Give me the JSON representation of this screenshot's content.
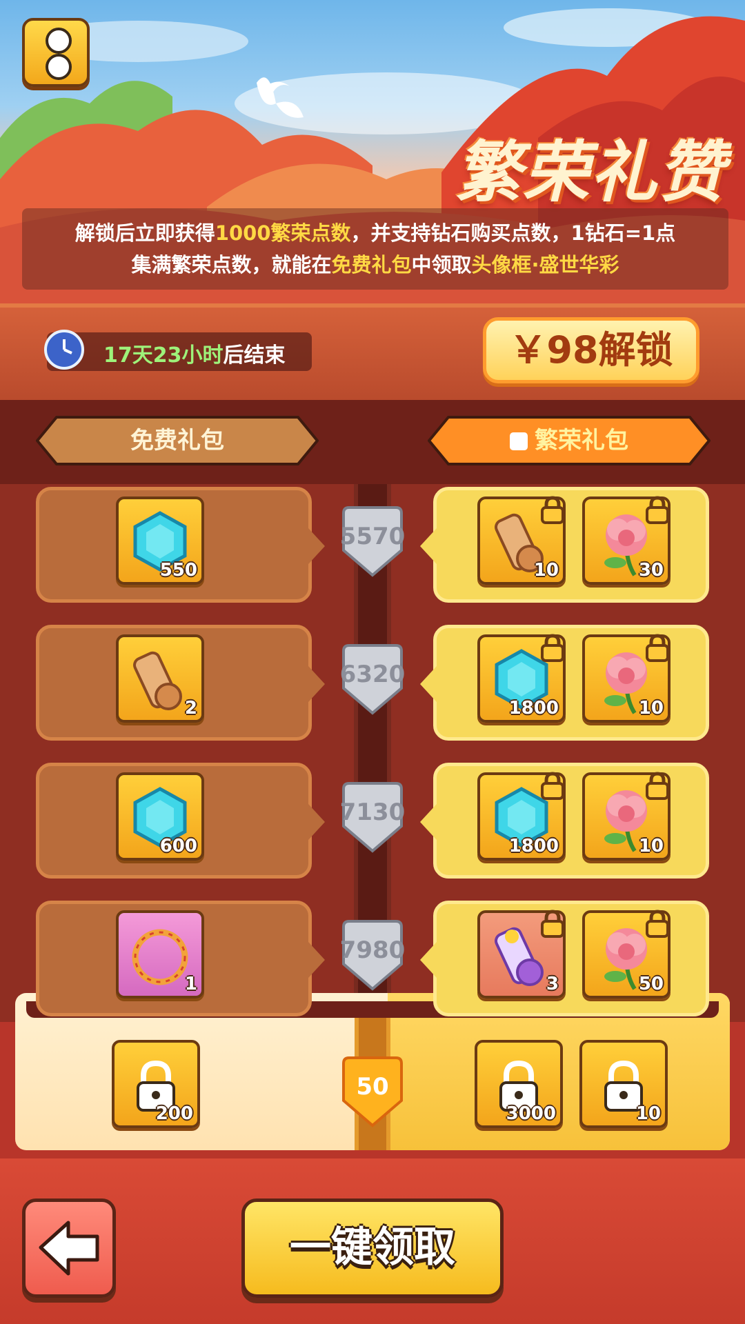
{
  "banner": {
    "title": "繁荣礼赞",
    "desc_line1": {
      "a": "解锁后立即获得",
      "b": "1000繁荣点数",
      "c": "，并支持钻石购买点数，1钻石=1点"
    },
    "desc_line2": {
      "a": "集满繁荣点数，就能在",
      "b": "免费礼包",
      "c": "中领取",
      "d": "头像框·盛世华彩"
    }
  },
  "header": {
    "timer_green": "17天23小时",
    "timer_suffix": "后结束",
    "unlock_label": "￥98解锁"
  },
  "tabs": {
    "free": "免费礼包",
    "premium": "繁荣礼包"
  },
  "rows": [
    {
      "points": "5570",
      "free": {
        "icon": "gem-icon",
        "count": "550"
      },
      "premium": [
        {
          "icon": "scroll-icon",
          "count": "10"
        },
        {
          "icon": "peony-icon",
          "count": "30"
        }
      ]
    },
    {
      "points": "6320",
      "free": {
        "icon": "scroll-icon",
        "count": "2"
      },
      "premium": [
        {
          "icon": "gem-icon",
          "count": "1800"
        },
        {
          "icon": "peony-icon",
          "count": "10"
        }
      ]
    },
    {
      "points": "7130",
      "free": {
        "icon": "gem-icon",
        "count": "600"
      },
      "premium": [
        {
          "icon": "gem-icon",
          "count": "1800"
        },
        {
          "icon": "peony-icon",
          "count": "10"
        }
      ]
    },
    {
      "points": "7980",
      "free": {
        "icon": "avatar-frame-icon",
        "count": "1",
        "frame_text": "盛世华彩"
      },
      "premium": [
        {
          "icon": "purple-scroll-icon",
          "count": "3"
        },
        {
          "icon": "peony-icon",
          "count": "50"
        }
      ]
    }
  ],
  "bottom_reward": {
    "points": "50",
    "free": {
      "icon": "locked-gem-icon",
      "count": "200"
    },
    "premium": [
      {
        "icon": "locked-gem-icon",
        "count": "3000"
      },
      {
        "icon": "locked-peony-icon",
        "count": "10"
      }
    ]
  },
  "actions": {
    "claim_all": "一键领取"
  },
  "colors": {
    "highlight": "#ffd944",
    "timer_green": "#9ef27a",
    "free_panel": "#b96c3b",
    "premium_panel": "#f7d95b"
  }
}
